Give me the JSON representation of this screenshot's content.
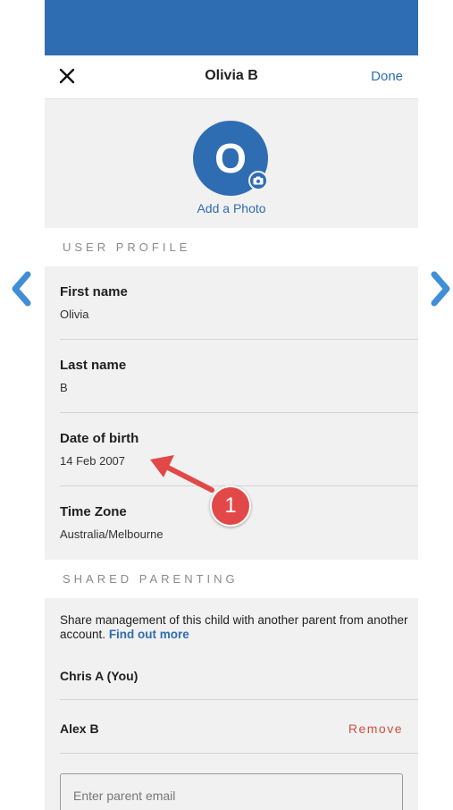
{
  "header": {
    "title": "Olivia B",
    "done_label": "Done"
  },
  "photo": {
    "avatar_initial": "O",
    "add_photo_label": "Add a Photo"
  },
  "user_profile": {
    "section_title": "USER PROFILE",
    "fields": [
      {
        "label": "First name",
        "value": "Olivia"
      },
      {
        "label": "Last name",
        "value": "B"
      },
      {
        "label": "Date of birth",
        "value": "14 Feb 2007"
      },
      {
        "label": "Time Zone",
        "value": "Australia/Melbourne"
      }
    ]
  },
  "shared_parenting": {
    "section_title": "SHARED PARENTING",
    "description": "Share management of this child with another parent from another account.",
    "find_out_more": "Find out more",
    "parents": [
      {
        "name": "Chris A (You)"
      },
      {
        "name": "Alex B",
        "action": "Remove"
      }
    ],
    "email_placeholder": "Enter parent email"
  },
  "annotation": {
    "badge_number": "1"
  },
  "colors": {
    "brand_blue": "#2f6db3",
    "remove_red": "#d0503f",
    "annotation_red": "#e34848",
    "nav_arrow_blue": "#3f8ed8"
  },
  "icons": {
    "close": "close-icon",
    "camera": "camera-icon",
    "previous": "chevron-left-icon",
    "next": "chevron-right-icon"
  }
}
